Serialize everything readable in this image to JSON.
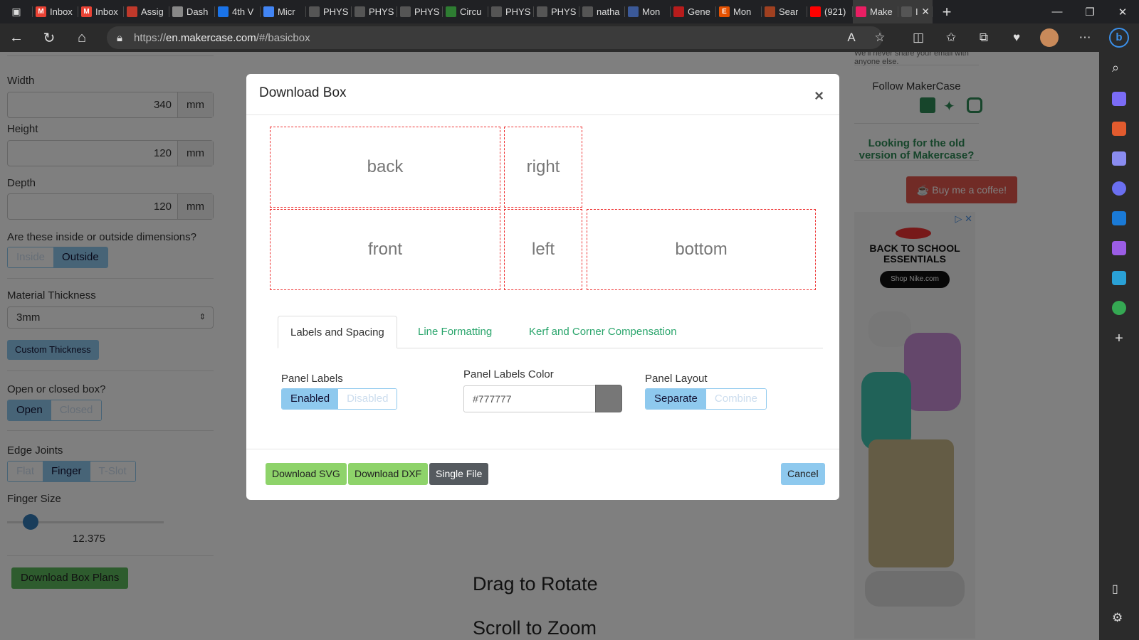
{
  "browser": {
    "tabs": [
      {
        "title": "Inbox",
        "fav": "M",
        "color": "#ea4335"
      },
      {
        "title": "Inbox",
        "fav": "M",
        "color": "#ea4335"
      },
      {
        "title": "Assig",
        "fav": "",
        "color": "#c0392b"
      },
      {
        "title": "Dash",
        "fav": "",
        "color": "#888"
      },
      {
        "title": "4th V",
        "fav": "",
        "color": "#1a73e8"
      },
      {
        "title": "Micr",
        "fav": "",
        "color": "#4285f4"
      },
      {
        "title": "PHYS",
        "fav": "",
        "color": "#555"
      },
      {
        "title": "PHYS",
        "fav": "",
        "color": "#555"
      },
      {
        "title": "PHYS",
        "fav": "",
        "color": "#555"
      },
      {
        "title": "Circu",
        "fav": "",
        "color": "#2e7d32"
      },
      {
        "title": "PHYS",
        "fav": "",
        "color": "#555"
      },
      {
        "title": "PHYS",
        "fav": "",
        "color": "#555"
      },
      {
        "title": "natha",
        "fav": "",
        "color": "#555"
      },
      {
        "title": "Mon",
        "fav": "",
        "color": "#3b5998"
      },
      {
        "title": "Gene",
        "fav": "",
        "color": "#b71c1c"
      },
      {
        "title": "Mon",
        "fav": "E",
        "color": "#e65100"
      },
      {
        "title": "Sear",
        "fav": "",
        "color": "#a04020"
      },
      {
        "title": "(921)",
        "fav": "",
        "color": "#ff0000"
      },
      {
        "title": "Make",
        "fav": "",
        "color": "#e91e63"
      },
      {
        "title": "I",
        "fav": "",
        "color": "#555"
      }
    ],
    "url_prefix": "https://",
    "url_host": "en.makercase.com",
    "url_path": "/#/basicbox"
  },
  "left": {
    "width_label": "Width",
    "width_value": "340",
    "unit": "mm",
    "height_label": "Height",
    "height_value": "120",
    "depth_label": "Depth",
    "depth_value": "120",
    "dims_question": "Are these inside or outside dimensions?",
    "inside": "Inside",
    "outside": "Outside",
    "material_label": "Material Thickness",
    "material_value": "3mm",
    "custom_thickness": "Custom Thickness",
    "open_closed_label": "Open or closed box?",
    "open": "Open",
    "closed": "Closed",
    "edge_joints_label": "Edge Joints",
    "flat": "Flat",
    "finger": "Finger",
    "tslot": "T-Slot",
    "finger_size_label": "Finger Size",
    "finger_size_value": "12.375",
    "finger_size_fraction": 0.1,
    "download_plans": "Download Box Plans"
  },
  "center": {
    "drag_to_rotate": "Drag to Rotate",
    "scroll_to_zoom": "Scroll to Zoom"
  },
  "right": {
    "share_note": "We'll never share your email with anyone else.",
    "follow": "Follow MakerCase",
    "old_version": "Looking for the old version of Makercase?",
    "coffee": "Buy me a coffee!",
    "ad_title": "BACK TO SCHOOL ESSENTIALS",
    "ad_button": "Shop Nike.com"
  },
  "modal": {
    "title": "Download Box",
    "close": "×",
    "panels": {
      "back": "back",
      "right": "right",
      "front": "front",
      "left": "left",
      "bottom": "bottom"
    },
    "tabs": [
      "Labels and Spacing",
      "Line Formatting",
      "Kerf and Corner Compensation"
    ],
    "panel_labels": "Panel Labels",
    "enabled": "Enabled",
    "disabled": "Disabled",
    "labels_color_label": "Panel Labels Color",
    "labels_color": "#777777",
    "panel_layout": "Panel Layout",
    "separate": "Separate",
    "combine": "Combine",
    "download_svg": "Download SVG",
    "download_dxf": "Download DXF",
    "single_file": "Single File",
    "cancel": "Cancel"
  }
}
